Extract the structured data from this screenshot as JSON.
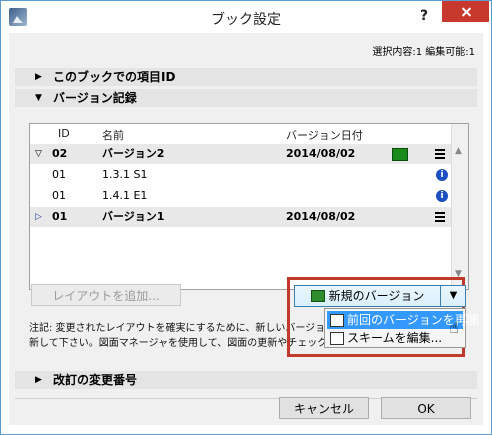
{
  "window": {
    "title": "ブック設定",
    "help": "?"
  },
  "selection_info": "選択内容:1 編集可能:1",
  "sections": {
    "item_id": "このブックでの項目ID",
    "version_history": "バージョン記録",
    "revision_number": "改訂の変更番号"
  },
  "table": {
    "headers": {
      "id": "ID",
      "name": "名前",
      "date": "バージョン日付"
    },
    "rows": [
      {
        "id": "02",
        "name": "バージョン2",
        "date": "2014/08/02"
      },
      {
        "id": "01",
        "name": "1.3.1 S1",
        "date": ""
      },
      {
        "id": "01",
        "name": "1.4.1 E1",
        "date": ""
      },
      {
        "id": "01",
        "name": "バージョン1",
        "date": "2014/08/02"
      }
    ]
  },
  "buttons": {
    "add_layout": "レイアウトを追加...",
    "new_version": "新規のバージョン",
    "cancel": "キャンセル",
    "ok": "OK"
  },
  "dropdown": {
    "items": [
      {
        "label": "前回のバージョンを再開"
      },
      {
        "label": "スキームを編集..."
      }
    ]
  },
  "note": {
    "line1": "注記: 変更されたレイアウトを確実にするために、新しいバージョンを作",
    "line2": "新して下さい。図面マネージャを使用して、図面の更新やチェックを行い"
  },
  "colors": {
    "highlight_frame": "#c0392b",
    "close_button": "#c7392d",
    "menu_selected": "#3399ff"
  }
}
